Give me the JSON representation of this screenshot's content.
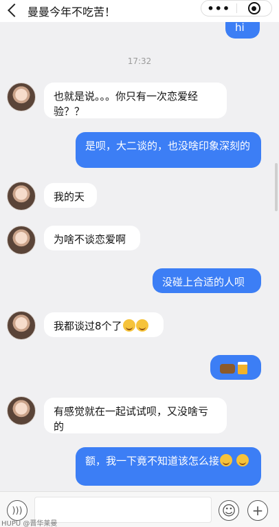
{
  "header": {
    "title": "曼曼今年不吃苦！",
    "more_label": "•••"
  },
  "chat": {
    "timestamp": "17:32",
    "messages": [
      {
        "side": "out",
        "text": "hi"
      },
      {
        "side": "in",
        "text": "也就是说。。。你只有一次恋爱经验？？"
      },
      {
        "side": "out",
        "text": "是呗，大二谈的，也没啥印象深刻的"
      },
      {
        "side": "in",
        "text": "我的天"
      },
      {
        "side": "in",
        "text": "为啥不谈恋爱啊"
      },
      {
        "side": "out",
        "text": "没碰上合适的人呗"
      },
      {
        "side": "in",
        "text": "我都谈过8个了"
      },
      {
        "side": "out",
        "text": ""
      },
      {
        "side": "in",
        "text": "有感觉就在一起试试呗，又没啥亏的"
      },
      {
        "side": "out",
        "text": "额，我一下竟不知道该怎么接"
      }
    ]
  },
  "icons": {
    "back": "chevron-left-icon",
    "close": "target-icon",
    "voice": "voice-icon",
    "emoji": "smiley-icon",
    "plus": "plus-icon"
  },
  "input": {
    "placeholder": ""
  },
  "watermark": "HUPU @晋华莱曼",
  "colors": {
    "outgoing_bubble": "#3c7ef5",
    "incoming_bubble": "#ffffff",
    "background": "#f0f0f2"
  }
}
